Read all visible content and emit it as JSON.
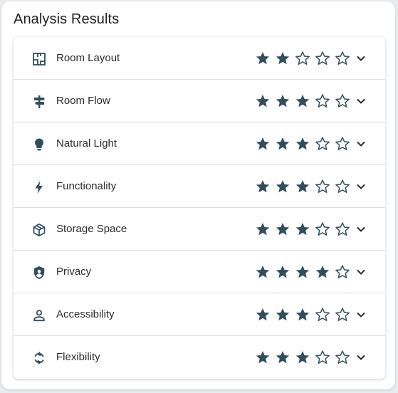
{
  "header": {
    "title": "Analysis Results"
  },
  "theme": {
    "icon_color": "#2f4f5f",
    "star_color": "#2f4f5f",
    "max_rating": 5
  },
  "categories": [
    {
      "label": "Room Layout",
      "icon": "floor-plan-icon",
      "rating": 2
    },
    {
      "label": "Room Flow",
      "icon": "signpost-icon",
      "rating": 3
    },
    {
      "label": "Natural Light",
      "icon": "lightbulb-icon",
      "rating": 3
    },
    {
      "label": "Functionality",
      "icon": "lightning-bolt-icon",
      "rating": 3
    },
    {
      "label": "Storage Space",
      "icon": "package-box-icon",
      "rating": 3
    },
    {
      "label": "Privacy",
      "icon": "shield-person-icon",
      "rating": 4
    },
    {
      "label": "Accessibility",
      "icon": "person-icon",
      "rating": 3
    },
    {
      "label": "Flexibility",
      "icon": "sync-arrows-icon",
      "rating": 3
    }
  ]
}
